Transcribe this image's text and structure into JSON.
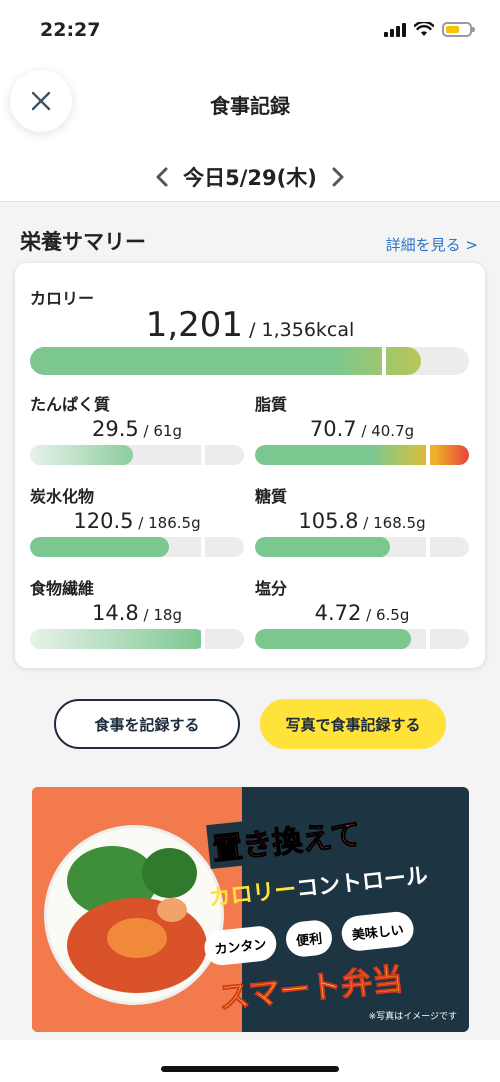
{
  "status_bar": {
    "time": "22:27"
  },
  "header": {
    "title": "食事記録",
    "date": "今日5/29(木)"
  },
  "summary": {
    "title": "栄養サマリー",
    "detail_link": "詳細を見る >",
    "calorie": {
      "label": "カロリー",
      "value": "1,201",
      "target": " / 1,356kcal",
      "progress": 0.89
    },
    "nutrients": [
      {
        "label": "たんぱく質",
        "value": "29.5",
        "target": " / 61g",
        "progress": 0.48
      },
      {
        "label": "脂質",
        "value": "70.7",
        "target": " / 40.7g",
        "progress": 1.0
      },
      {
        "label": "炭水化物",
        "value": "120.5",
        "target": " / 186.5g",
        "progress": 0.65
      },
      {
        "label": "糖質",
        "value": "105.8",
        "target": " / 168.5g",
        "progress": 0.63
      },
      {
        "label": "食物繊維",
        "value": "14.8",
        "target": " / 18g",
        "progress": 0.82
      },
      {
        "label": "塩分",
        "value": "4.72",
        "target": " / 6.5g",
        "progress": 0.73
      }
    ]
  },
  "buttons": {
    "record": "食事を記録する",
    "photo_record": "写真で食事記録する"
  },
  "banner": {
    "line1": "置き換えて",
    "line2_a": "カロリー",
    "line2_b": "コントロール",
    "pills": [
      "カンタン",
      "便利",
      "美味しい"
    ],
    "line4": "スマート弁当",
    "note": "※写真はイメージです"
  },
  "colors": {
    "accent_green": "#7cc78f",
    "warning_red": "#e8443a",
    "link_blue": "#2d73c9",
    "button_yellow": "#ffe23a",
    "navy": "#1d2b3a"
  }
}
